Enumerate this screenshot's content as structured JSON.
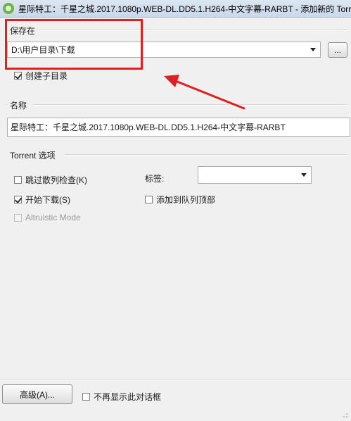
{
  "window": {
    "title": "星际特工：千星之城.2017.1080p.WEB-DL.DD5.1.H264-中文字幕-RARBT - 添加新的 Torrent"
  },
  "save": {
    "group_label": "保存在",
    "path_value": "D:\\用户目录\\下载",
    "browse_label": "...",
    "create_subdir_label": "创建子目录",
    "create_subdir_checked": true
  },
  "name": {
    "group_label": "名称",
    "value": "星际特工：千星之城.2017.1080p.WEB-DL.DD5.1.H264-中文字幕-RARBT"
  },
  "torrent_options": {
    "group_label": "Torrent 选项",
    "skip_hash_label": "跳过散列检查(K)",
    "skip_hash_checked": false,
    "start_download_label": "开始下载(S)",
    "start_download_checked": true,
    "altruistic_label": "Altruistic Mode",
    "altruistic_checked": false,
    "tag_label": "标签:",
    "tag_value": "",
    "add_to_top_label": "添加到队列顶部",
    "add_to_top_checked": false
  },
  "footer": {
    "advanced_label": "高级(A)...",
    "dont_show_label": "不再显示此对话框",
    "dont_show_checked": false
  },
  "annotation": {
    "highlight_color": "#e02020"
  }
}
